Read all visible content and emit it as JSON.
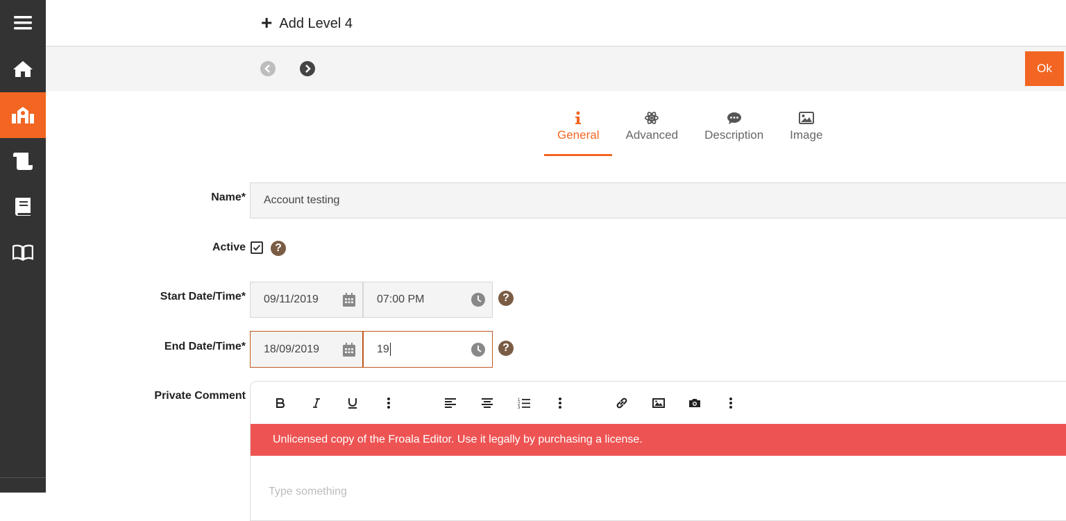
{
  "header": {
    "add_label": "Add Level 4",
    "plus_glyph": "+"
  },
  "navigation": {
    "ok_label": "Ok"
  },
  "sidebar": {
    "items": [
      {
        "icon": "hamburger-icon"
      },
      {
        "icon": "home-icon"
      },
      {
        "icon": "school-icon",
        "active": true
      },
      {
        "icon": "scroll-icon"
      },
      {
        "icon": "book-icon"
      },
      {
        "icon": "open-book-icon"
      }
    ]
  },
  "tabs": [
    {
      "label": "General",
      "icon": "info-icon",
      "active": true
    },
    {
      "label": "Advanced",
      "icon": "atom-icon"
    },
    {
      "label": "Description",
      "icon": "comment-icon"
    },
    {
      "label": "Image",
      "icon": "image-icon"
    }
  ],
  "form": {
    "name_label": "Name*",
    "name_value": "Account testing",
    "active_label": "Active",
    "active_checked": true,
    "start_label": "Start Date/Time*",
    "start_date": "09/11/2019",
    "start_time": "07:00 PM",
    "end_label": "End Date/Time*",
    "end_date": "18/09/2019",
    "end_time": "19",
    "comment_label": "Private Comment",
    "help_glyph": "?"
  },
  "editor": {
    "license_text": "Unlicensed copy of the Froala Editor. Use it legally by purchasing a license.",
    "placeholder": "Type something",
    "toolbar": [
      "bold-icon",
      "italic-icon",
      "underline-icon",
      "more-text-icon",
      "align-left-icon",
      "align-center-icon",
      "ordered-list-icon",
      "more-paragraph-icon",
      "link-icon",
      "image-icon",
      "camera-icon",
      "more-rich-icon"
    ]
  },
  "colors": {
    "accent": "#f26522",
    "sidebar": "#333333",
    "license_bar": "#ee5353",
    "help": "#7a5c44"
  }
}
